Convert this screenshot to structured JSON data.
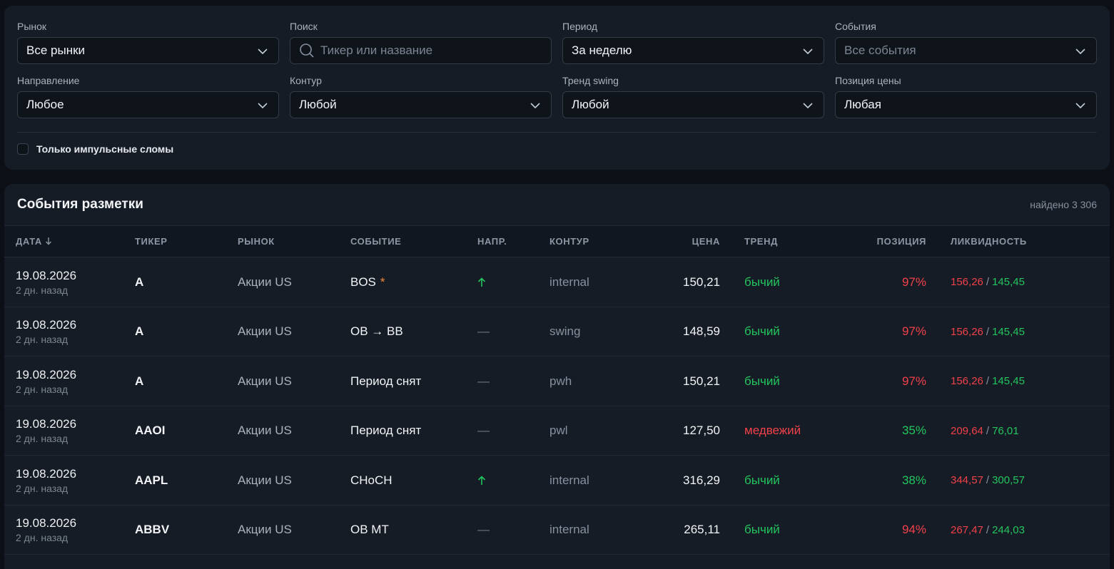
{
  "filters": {
    "market": {
      "label": "Рынок",
      "value": "Все рынки"
    },
    "search": {
      "label": "Поиск",
      "placeholder": "Тикер или название"
    },
    "period": {
      "label": "Период",
      "value": "За неделю"
    },
    "events": {
      "label": "События",
      "placeholder": "Все события"
    },
    "direction": {
      "label": "Направление",
      "value": "Любое"
    },
    "contour": {
      "label": "Контур",
      "value": "Любой"
    },
    "trend_swing": {
      "label": "Тренд swing",
      "value": "Любой"
    },
    "price_position": {
      "label": "Позиция цены",
      "value": "Любая"
    },
    "impulse_only": {
      "label": "Только импульсные сломы",
      "checked": false
    }
  },
  "events_table": {
    "title": "События разметки",
    "count": "найдено 3 306",
    "columns": {
      "date": "ДАТА",
      "ticker": "ТИКЕР",
      "market": "РЫНОК",
      "event": "СОБЫТИЕ",
      "direction": "НАПР.",
      "contour": "КОНТУР",
      "price": "ЦЕНА",
      "trend": "ТРЕНД",
      "position": "ПОЗИЦИЯ",
      "liquidity": "ЛИКВИДНОСТЬ"
    },
    "rows": [
      {
        "date": "19.08.2026",
        "ago": "2 дн. назад",
        "ticker": "A",
        "market": "Акции US",
        "event": "BOS",
        "star": "*",
        "direction": "up",
        "contour": "internal",
        "price": "150,21",
        "trend": "бычий",
        "trend_color": "green",
        "position": "97%",
        "position_color": "red",
        "liq_high": "156,26",
        "liq_low": "145,45"
      },
      {
        "date": "19.08.2026",
        "ago": "2 дн. назад",
        "ticker": "A",
        "market": "Акции US",
        "event": "OB → BB",
        "star": "",
        "direction": "none",
        "contour": "swing",
        "price": "148,59",
        "trend": "бычий",
        "trend_color": "green",
        "position": "97%",
        "position_color": "red",
        "liq_high": "156,26",
        "liq_low": "145,45"
      },
      {
        "date": "19.08.2026",
        "ago": "2 дн. назад",
        "ticker": "A",
        "market": "Акции US",
        "event": "Период снят",
        "star": "",
        "direction": "none",
        "contour": "pwh",
        "price": "150,21",
        "trend": "бычий",
        "trend_color": "green",
        "position": "97%",
        "position_color": "red",
        "liq_high": "156,26",
        "liq_low": "145,45"
      },
      {
        "date": "19.08.2026",
        "ago": "2 дн. назад",
        "ticker": "AAOI",
        "market": "Акции US",
        "event": "Период снят",
        "star": "",
        "direction": "none",
        "contour": "pwl",
        "price": "127,50",
        "trend": "медвежий",
        "trend_color": "red",
        "position": "35%",
        "position_color": "green",
        "liq_high": "209,64",
        "liq_low": "76,01"
      },
      {
        "date": "19.08.2026",
        "ago": "2 дн. назад",
        "ticker": "AAPL",
        "market": "Акции US",
        "event": "CHoCH",
        "star": "",
        "direction": "up",
        "contour": "internal",
        "price": "316,29",
        "trend": "бычий",
        "trend_color": "green",
        "position": "38%",
        "position_color": "green",
        "liq_high": "344,57",
        "liq_low": "300,57"
      },
      {
        "date": "19.08.2026",
        "ago": "2 дн. назад",
        "ticker": "ABBV",
        "market": "Акции US",
        "event": "OB MT",
        "star": "",
        "direction": "none",
        "contour": "internal",
        "price": "265,11",
        "trend": "бычий",
        "trend_color": "green",
        "position": "94%",
        "position_color": "red",
        "liq_high": "267,47",
        "liq_low": "244,03"
      }
    ],
    "dash": "—",
    "colors": {
      "red": "#f0414a",
      "green": "#22c55e",
      "star": "#f0883e"
    }
  }
}
